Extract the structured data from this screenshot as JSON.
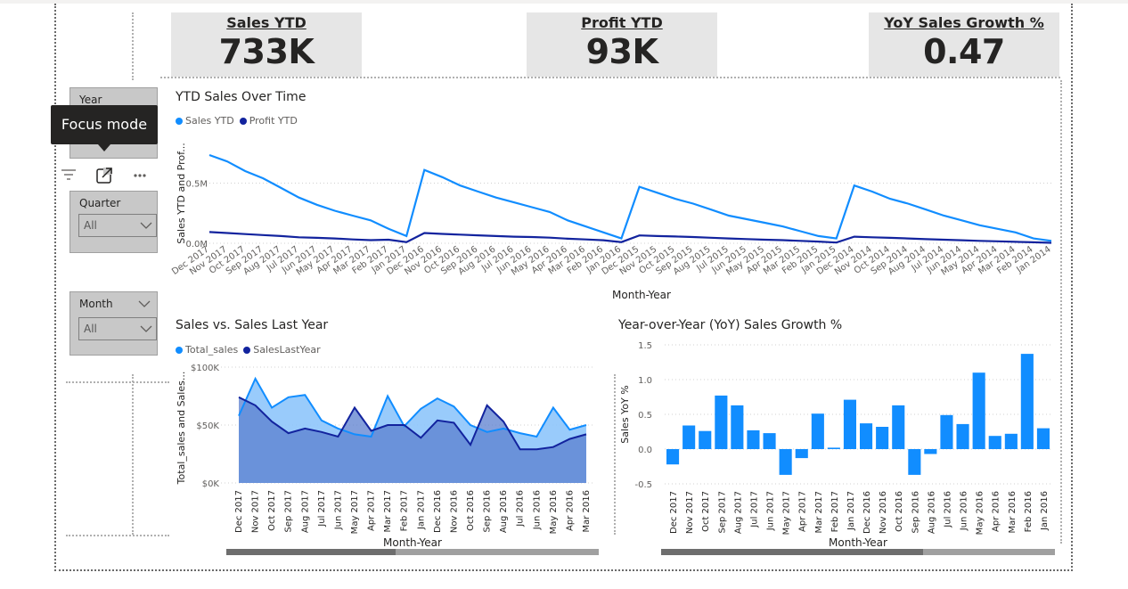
{
  "kpis": [
    {
      "label": "Sales YTD",
      "value": "733K"
    },
    {
      "label": "Profit YTD",
      "value": "93K"
    },
    {
      "label": "YoY Sales Growth %",
      "value": "0.47"
    }
  ],
  "slicers": {
    "year": {
      "title": "Year"
    },
    "quarter": {
      "title": "Quarter",
      "value": "All"
    },
    "month": {
      "title": "Month",
      "value": "All"
    }
  },
  "tooltip": {
    "text": "Focus mode"
  },
  "header_icons": [
    "filter-icon",
    "focus-mode-icon",
    "more-options-icon"
  ],
  "colors": {
    "light_blue": "#118dff",
    "dark_blue": "#12239e",
    "area_light": "#8ec5fb",
    "area_dark": "#5b7fcf"
  },
  "chart_data": [
    {
      "type": "line",
      "title": "YTD Sales Over Time",
      "xlabel": "Month-Year",
      "ylabel": "Sales YTD and Prof...",
      "yticks": [
        "0.0M",
        "0.5M"
      ],
      "categories": [
        "Dec 2017",
        "Nov 2017",
        "Oct 2017",
        "Sep 2017",
        "Aug 2017",
        "Jul 2017",
        "Jun 2017",
        "May 2017",
        "Apr 2017",
        "Mar 2017",
        "Feb 2017",
        "Jan 2017",
        "Dec 2016",
        "Nov 2016",
        "Oct 2016",
        "Sep 2016",
        "Aug 2016",
        "Jul 2016",
        "Jun 2016",
        "May 2016",
        "Apr 2016",
        "Mar 2016",
        "Feb 2016",
        "Jan 2016",
        "Dec 2015",
        "Nov 2015",
        "Oct 2015",
        "Sep 2015",
        "Aug 2015",
        "Jul 2015",
        "Jun 2015",
        "May 2015",
        "Apr 2015",
        "Mar 2015",
        "Feb 2015",
        "Jan 2015",
        "Dec 2014",
        "Nov 2014",
        "Oct 2014",
        "Sep 2014",
        "Aug 2014",
        "Jul 2014",
        "Jun 2014",
        "May 2014",
        "Apr 2014",
        "Mar 2014",
        "Feb 2014",
        "Jan 2014"
      ],
      "series": [
        {
          "name": "Sales YTD",
          "values": [
            0.733,
            0.68,
            0.6,
            0.54,
            0.46,
            0.38,
            0.32,
            0.27,
            0.23,
            0.19,
            0.12,
            0.06,
            0.61,
            0.55,
            0.48,
            0.43,
            0.38,
            0.34,
            0.3,
            0.26,
            0.19,
            0.14,
            0.09,
            0.04,
            0.47,
            0.42,
            0.37,
            0.33,
            0.28,
            0.23,
            0.2,
            0.17,
            0.14,
            0.1,
            0.06,
            0.04,
            0.48,
            0.43,
            0.37,
            0.33,
            0.28,
            0.23,
            0.19,
            0.15,
            0.12,
            0.09,
            0.04,
            0.02
          ]
        },
        {
          "name": "Profit YTD",
          "values": [
            0.093,
            0.085,
            0.076,
            0.068,
            0.06,
            0.05,
            0.045,
            0.04,
            0.032,
            0.026,
            0.03,
            0.01,
            0.085,
            0.078,
            0.072,
            0.066,
            0.06,
            0.055,
            0.052,
            0.047,
            0.038,
            0.032,
            0.025,
            0.01,
            0.065,
            0.06,
            0.056,
            0.052,
            0.046,
            0.04,
            0.035,
            0.03,
            0.026,
            0.02,
            0.014,
            0.006,
            0.055,
            0.05,
            0.045,
            0.04,
            0.034,
            0.03,
            0.025,
            0.02,
            0.016,
            0.012,
            0.008,
            0.004
          ]
        }
      ],
      "ylim": [
        0,
        0.8
      ]
    },
    {
      "type": "area",
      "title": "Sales vs. Sales Last Year",
      "xlabel": "Month-Year",
      "ylabel": "Total_sales and Sales...",
      "yticks": [
        "$0K",
        "$50K",
        "$100K"
      ],
      "categories": [
        "Dec 2017",
        "Nov 2017",
        "Oct 2017",
        "Sep 2017",
        "Aug 2017",
        "Jul 2017",
        "Jun 2017",
        "May 2017",
        "Apr 2017",
        "Mar 2017",
        "Feb 2017",
        "Jan 2017",
        "Dec 2016",
        "Nov 2016",
        "Oct 2016",
        "Sep 2016",
        "Aug 2016",
        "Jul 2016",
        "Jun 2016",
        "May 2016",
        "Apr 2016",
        "Mar 2016"
      ],
      "series": [
        {
          "name": "Total_sales",
          "values": [
            58,
            90,
            65,
            74,
            76,
            54,
            47,
            42,
            40,
            75,
            49,
            64,
            73,
            66,
            50,
            44,
            47,
            43,
            40,
            65,
            46,
            50
          ]
        },
        {
          "name": "SalesLastYear",
          "values": [
            74,
            67,
            53,
            43,
            47,
            44,
            40,
            65,
            45,
            50,
            50,
            39,
            54,
            52,
            33,
            67,
            53,
            29,
            29,
            31,
            38,
            42
          ]
        }
      ],
      "ylim": [
        0,
        100
      ]
    },
    {
      "type": "bar",
      "title": "Year-over-Year (YoY) Sales Growth %",
      "xlabel": "Month-Year",
      "ylabel": "Sales YoY %",
      "yticks": [
        "-0.5",
        "0.0",
        "0.5",
        "1.0",
        "1.5"
      ],
      "categories": [
        "Dec 2017",
        "Nov 2017",
        "Oct 2017",
        "Sep 2017",
        "Aug 2017",
        "Jul 2017",
        "Jun 2017",
        "May 2017",
        "Apr 2017",
        "Mar 2017",
        "Feb 2017",
        "Jan 2017",
        "Dec 2016",
        "Nov 2016",
        "Oct 2016",
        "Sep 2016",
        "Aug 2016",
        "Jul 2016",
        "Jun 2016",
        "May 2016",
        "Apr 2016",
        "Mar 2016",
        "Feb 2016",
        "Jan 2016"
      ],
      "values": [
        -0.22,
        0.34,
        0.26,
        0.77,
        0.63,
        0.27,
        0.23,
        -0.37,
        -0.13,
        0.51,
        0.02,
        0.71,
        0.37,
        0.32,
        0.63,
        -0.37,
        -0.07,
        0.49,
        0.36,
        1.1,
        0.19,
        0.22,
        1.37,
        0.3
      ],
      "ylim": [
        -0.5,
        1.5
      ]
    }
  ]
}
